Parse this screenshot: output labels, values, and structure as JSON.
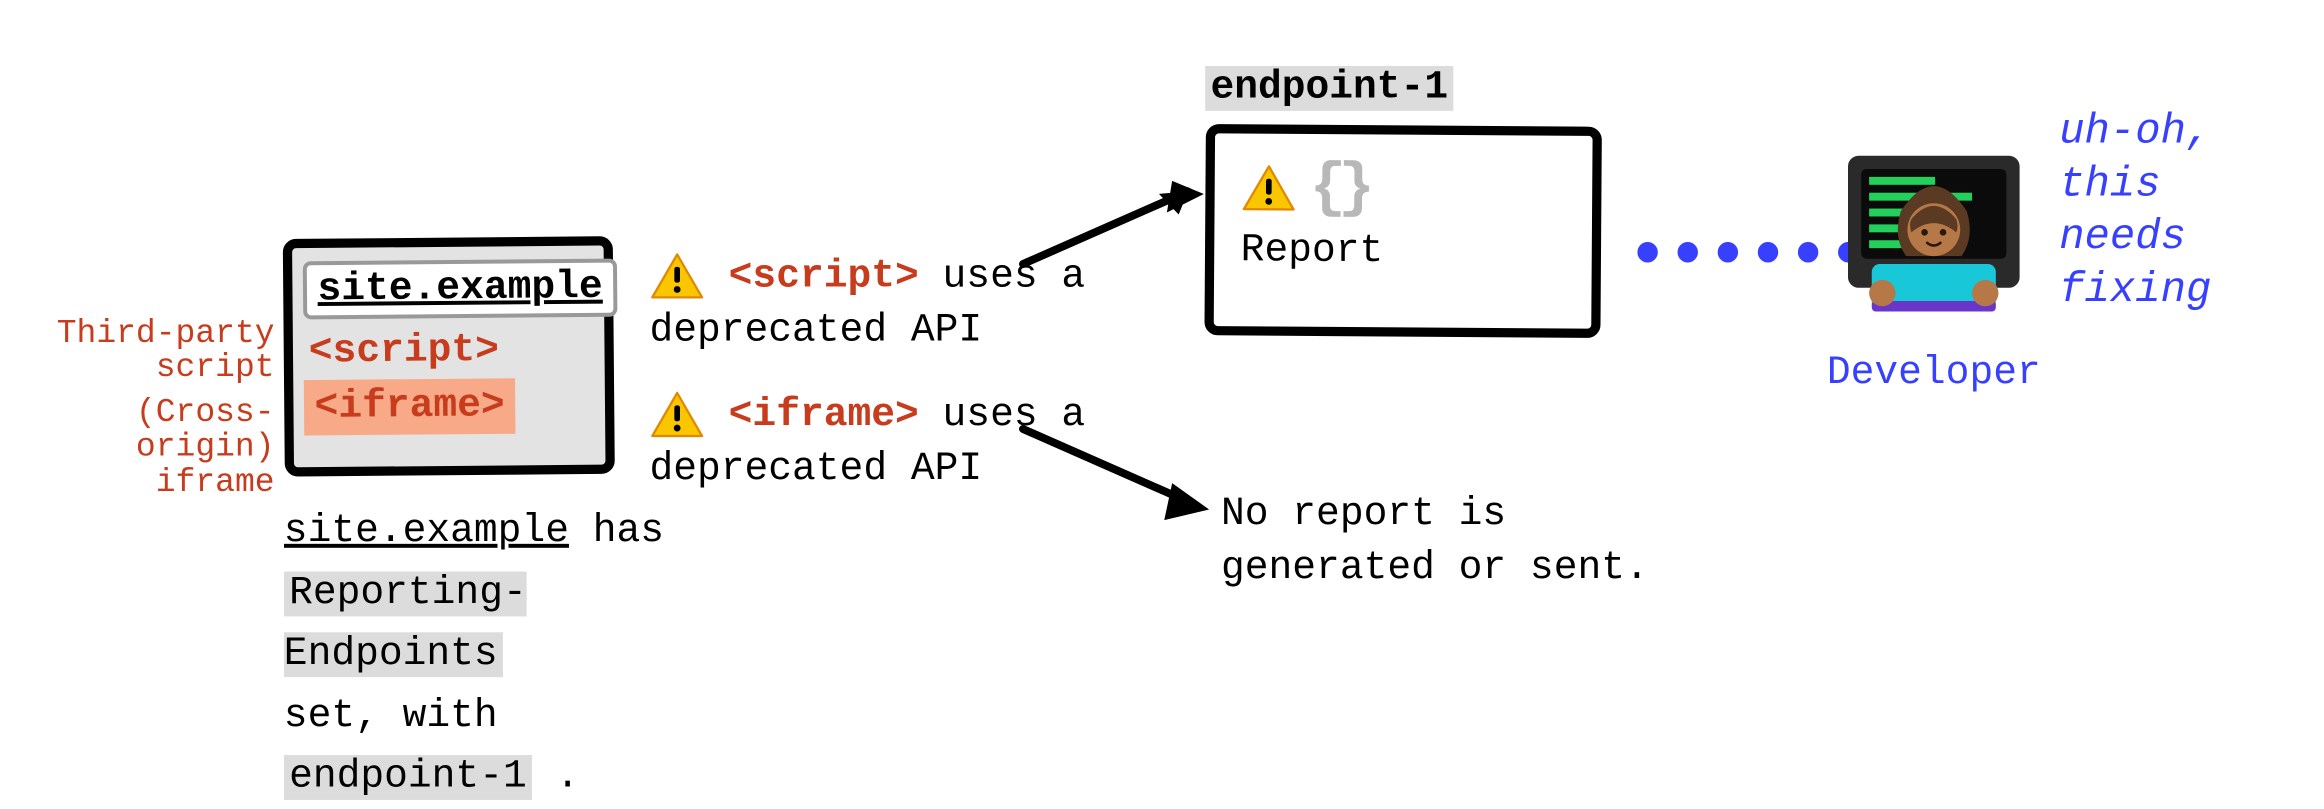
{
  "left_labels": {
    "script_l1": "Third-party",
    "script_l2": "script",
    "iframe_l1": "(Cross-origin)",
    "iframe_l2": "iframe"
  },
  "browser": {
    "address": "site.example",
    "script_tag": "<script>",
    "iframe_tag": "<iframe>"
  },
  "caption": {
    "p1_a": "site.example",
    "p1_b": " has ",
    "p2": "Reporting-Endpoints",
    "p3_a": "set, with ",
    "p3_b": "endpoint-1",
    "p3_c": " ."
  },
  "messages": {
    "script": {
      "tag": "<script>",
      "tail": " uses a deprecated API"
    },
    "iframe": {
      "tag": "<iframe>",
      "tail": " uses a deprecated API"
    }
  },
  "endpoint": {
    "name": "endpoint-1",
    "braces": "{}",
    "label": "Report"
  },
  "noreport": {
    "l1": "No report is",
    "l2": "generated or sent."
  },
  "developer": {
    "label": "Developer",
    "quote_l1": "uh-oh,",
    "quote_l2": "this",
    "quote_l3": "needs",
    "quote_l4": "fixing"
  },
  "dots": "••••••",
  "colors": {
    "red": "#c73c1d",
    "blue": "#3740ff",
    "peach": "#f7a988",
    "warn_fill": "#f9c600",
    "warn_stroke": "#e08900"
  }
}
